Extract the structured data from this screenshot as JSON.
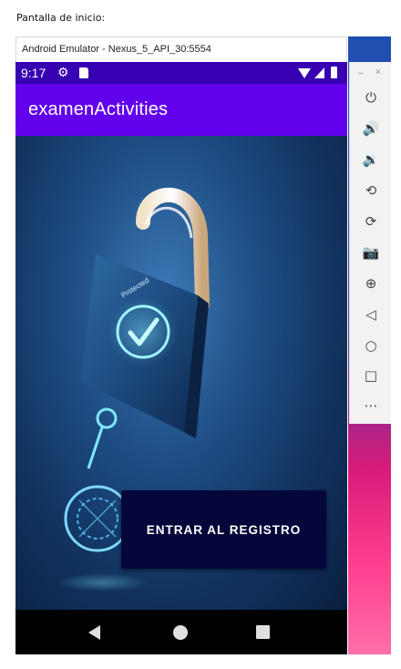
{
  "caption": "Pantalla de inicio:",
  "emulator": {
    "window_title": "Android Emulator - Nexus_5_API_30:5554",
    "minimize_glyph": "–",
    "close_glyph": "×",
    "toolbar": [
      {
        "icon": "power-icon",
        "glyph": "⏻"
      },
      {
        "icon": "volume-up-icon",
        "glyph": "🔊"
      },
      {
        "icon": "volume-down-icon",
        "glyph": "🔉"
      },
      {
        "icon": "rotate-left-icon",
        "glyph": "⟲"
      },
      {
        "icon": "rotate-right-icon",
        "glyph": "⟳"
      },
      {
        "icon": "camera-icon",
        "glyph": "📷"
      },
      {
        "icon": "zoom-icon",
        "glyph": "⊕"
      },
      {
        "icon": "back-icon",
        "glyph": "◁"
      },
      {
        "icon": "home-icon",
        "glyph": "○"
      },
      {
        "icon": "overview-icon",
        "glyph": "□"
      },
      {
        "icon": "more-icon",
        "glyph": "⋯"
      }
    ]
  },
  "status_bar": {
    "time": "9:17",
    "icons": [
      "gear-icon",
      "sd-card-icon",
      "wifi-icon",
      "signal-icon",
      "battery-icon"
    ]
  },
  "app_bar": {
    "title": "examenActivities"
  },
  "main": {
    "enter_button_label": "ENTRAR AL REGISTRO",
    "hero_image": "padlock-security-image",
    "padlock_text": "Protected"
  },
  "nav_bar": {
    "icons": [
      "nav-back-icon",
      "nav-home-icon",
      "nav-recents-icon"
    ]
  },
  "colors": {
    "status_bar": "#3700b3",
    "app_bar": "#6200ee",
    "button_bg": "#05073a",
    "nav_bar": "#000000"
  }
}
